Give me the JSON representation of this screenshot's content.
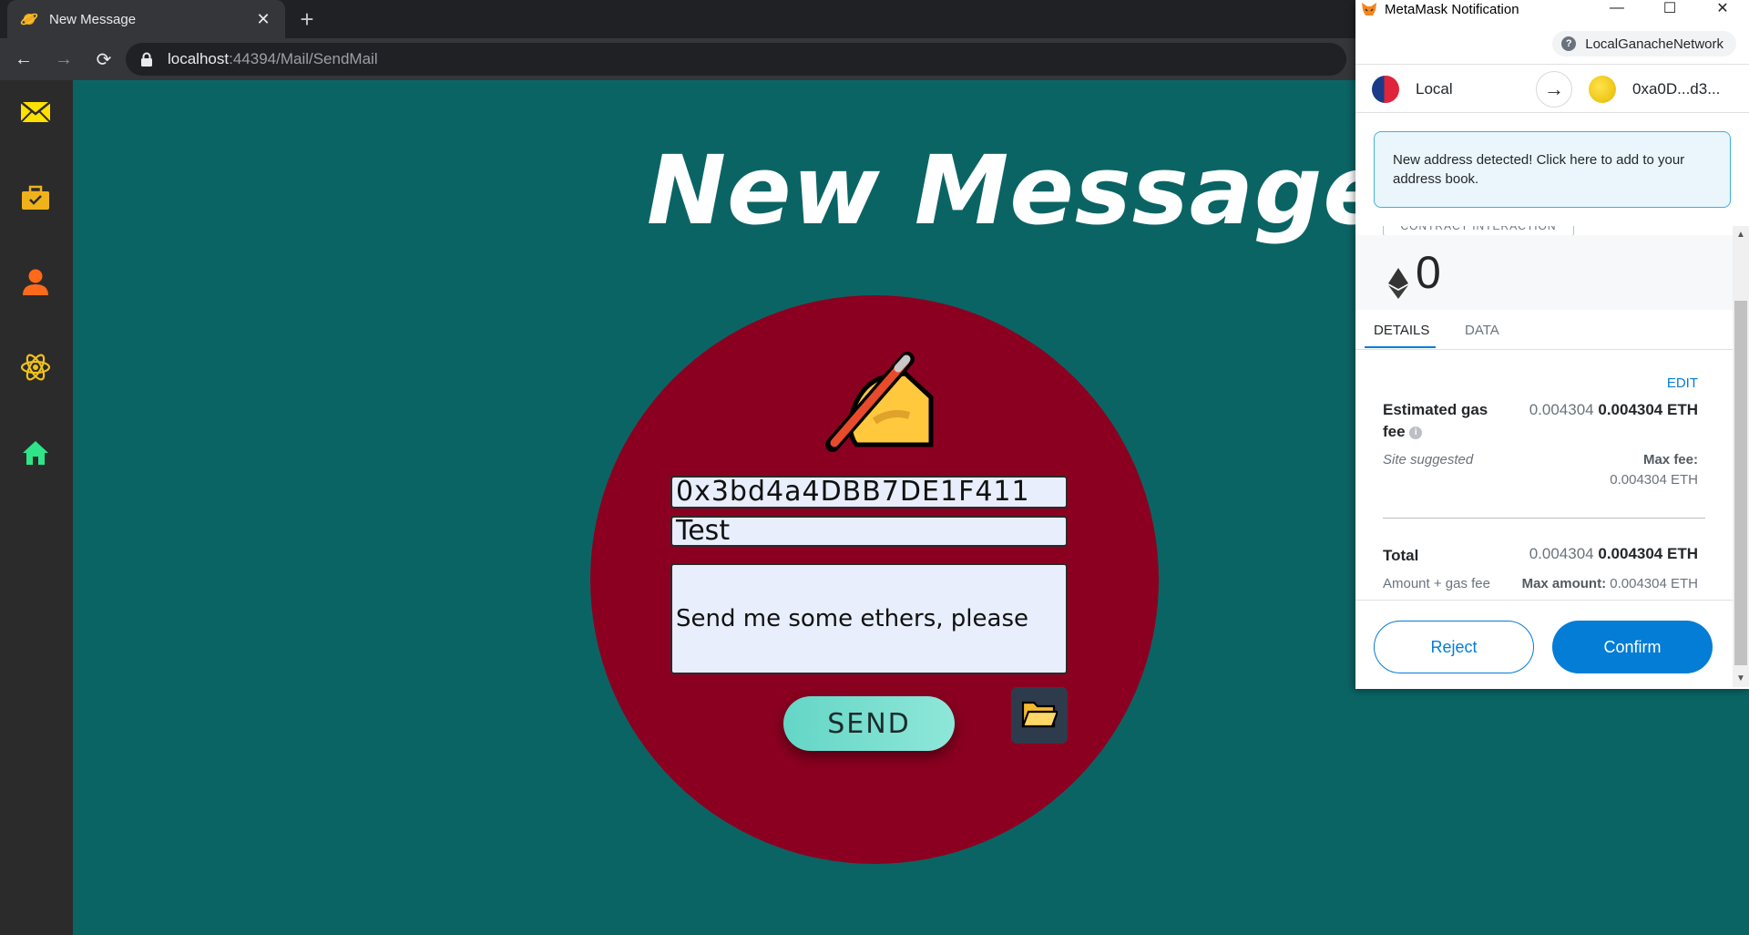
{
  "browser": {
    "tab_title": "New Message",
    "tab_close": "✕",
    "new_tab": "+",
    "url_host": "localhost",
    "url_rest": ":44394/Mail/SendMail",
    "nav_back": "←",
    "nav_forward": "→",
    "nav_reload": "⟳"
  },
  "sidebar": {
    "items": [
      {
        "icon": "mail-icon",
        "color": "#ffe100"
      },
      {
        "icon": "briefcase-icon",
        "color": "#f0b21a"
      },
      {
        "icon": "user-icon",
        "color": "#ff6a1a"
      },
      {
        "icon": "atom-icon",
        "color": "#f0c21a"
      },
      {
        "icon": "home-icon",
        "color": "#2ee58a"
      }
    ]
  },
  "compose": {
    "title": "New Message",
    "to_address": "0x3bd4a4DBB7DE1F411",
    "subject": "Test",
    "body": "Send me some ethers, please",
    "send_label": "SEND",
    "circle_color": "#8b0020"
  },
  "metamask": {
    "window_title": "MetaMask Notification",
    "network": "LocalGanacheNetwork",
    "network_help": "?",
    "from_account": "Local",
    "to_account": "0xa0D...d3...",
    "alert": "New address detected! Click here to add to your address book.",
    "contract_badge": "CONTRACT INTERACTION",
    "amount": "0",
    "tabs": [
      "DETAILS",
      "DATA"
    ],
    "edit_label": "EDIT",
    "gas_label": "Estimated gas fee",
    "gas_info": "i",
    "gas_value_secondary": "0.004304",
    "gas_value_primary": "0.004304 ETH",
    "site_suggested": "Site suggested",
    "max_fee_label": "Max fee:",
    "max_fee_value": "0.004304 ETH",
    "total_label": "Total",
    "total_secondary": "0.004304",
    "total_primary": "0.004304 ETH",
    "amount_gas_label": "Amount + gas fee",
    "max_amount_label": "Max amount:",
    "max_amount_value": "0.004304 ETH",
    "reject_label": "Reject",
    "confirm_label": "Confirm",
    "accent": "#037dd6"
  }
}
